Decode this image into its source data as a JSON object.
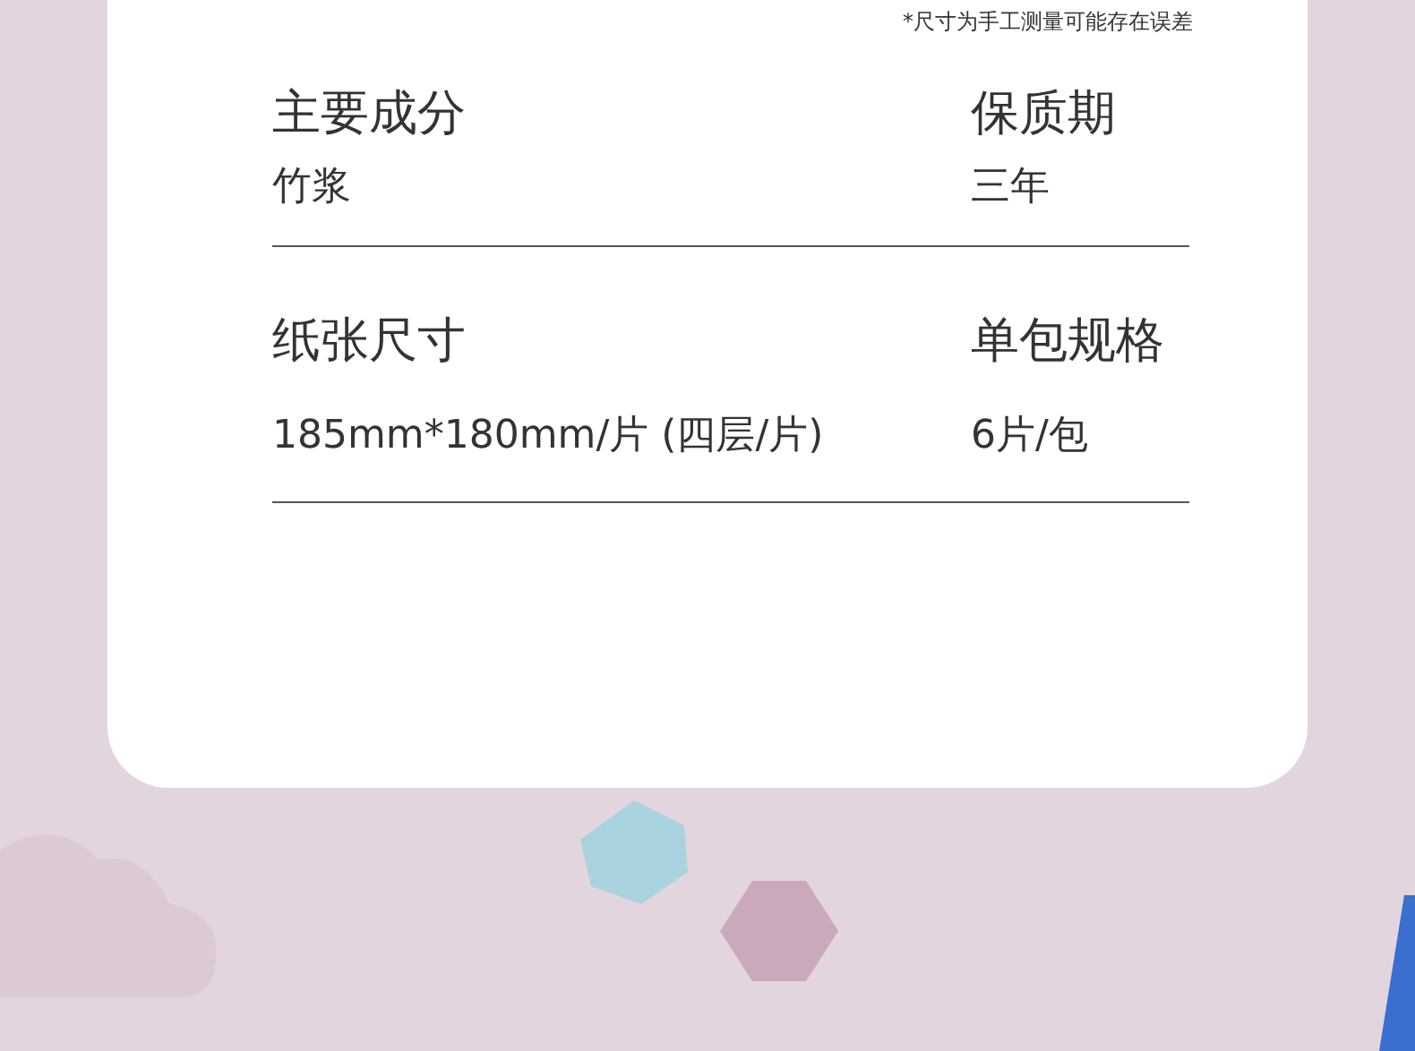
{
  "note": "*尺寸为手工测量可能存在误差",
  "specs": [
    {
      "label": "主要成分",
      "value": "竹浆"
    },
    {
      "label": "保质期",
      "value": "三年"
    },
    {
      "label": "纸张尺寸",
      "value": "185mm*180mm/片 (四层/片)"
    },
    {
      "label": "单包规格",
      "value": "6片/包"
    }
  ]
}
